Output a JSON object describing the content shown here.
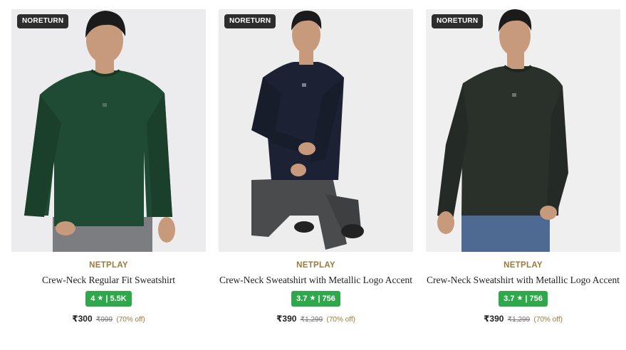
{
  "products": [
    {
      "badge": "NORETURN",
      "brand": "NETPLAY",
      "title": "Crew-Neck Regular Fit Sweatshirt",
      "rating": "4",
      "reviews": "5.5K",
      "price": "₹300",
      "mrp": "₹999",
      "discount": "(70% off)",
      "sweater_color": "#1f4a33",
      "bg_color": "#ececee"
    },
    {
      "badge": "NORETURN",
      "brand": "NETPLAY",
      "title": "Crew-Neck Sweatshirt with Metallic Logo Accent",
      "rating": "3.7",
      "reviews": "756",
      "price": "₹390",
      "mrp": "₹1,299",
      "discount": "(70% off)",
      "sweater_color": "#1c2233",
      "bg_color": "#ededed"
    },
    {
      "badge": "NORETURN",
      "brand": "NETPLAY",
      "title": "Crew-Neck Sweatshirt with Metallic Logo Accent",
      "rating": "3.7",
      "reviews": "756",
      "price": "₹390",
      "mrp": "₹1,299",
      "discount": "(70% off)",
      "sweater_color": "#2a312b",
      "bg_color": "#efefef"
    }
  ],
  "colors": {
    "badge_bg": "#2d2d2d",
    "rating_bg": "#2ea84a",
    "brand_text": "#9a7a3a"
  }
}
